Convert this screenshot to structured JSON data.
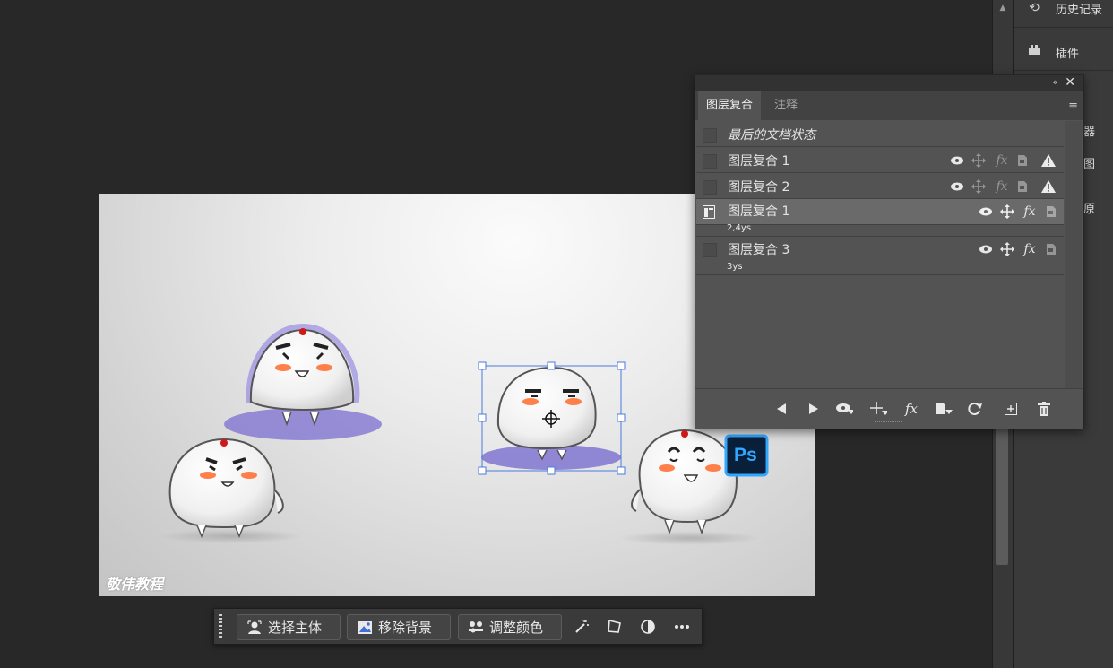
{
  "dock": {
    "history_label": "历史记录",
    "plugins_label": "插件",
    "frag1": "器",
    "frag2": "图",
    "frag3": "原"
  },
  "panel": {
    "tabs": [
      {
        "label": "图层复合",
        "active": true
      },
      {
        "label": "注释",
        "active": false
      }
    ],
    "rows": [
      {
        "name": "最后的文档状态",
        "italic": true
      },
      {
        "name": "图层复合 1",
        "sub": ""
      },
      {
        "name": "图层复合 2",
        "sub": ""
      },
      {
        "name": "图层复合 1",
        "sub": "2,4ys",
        "selected": true
      },
      {
        "name": "图层复合 3",
        "sub": "3ys"
      }
    ],
    "bottom_icons": [
      "prev-icon",
      "next-icon",
      "visibility-icon",
      "position-icon",
      "fx-icon",
      "update-icon",
      "refresh-icon",
      "new-comp-icon",
      "trash-icon"
    ]
  },
  "canvas": {
    "watermark": "敬伟教程",
    "badge": "Ps"
  },
  "taskbar": {
    "select_subject": "选择主体",
    "remove_bg": "移除背景",
    "adjust_color": "调整颜色"
  },
  "colors": {
    "ps_badge": "#0a1f3a",
    "ps_border": "#31a8ff",
    "arrow": "#e01e2a",
    "selection": "#4a7bdc",
    "glow": "#7b6fd0"
  }
}
